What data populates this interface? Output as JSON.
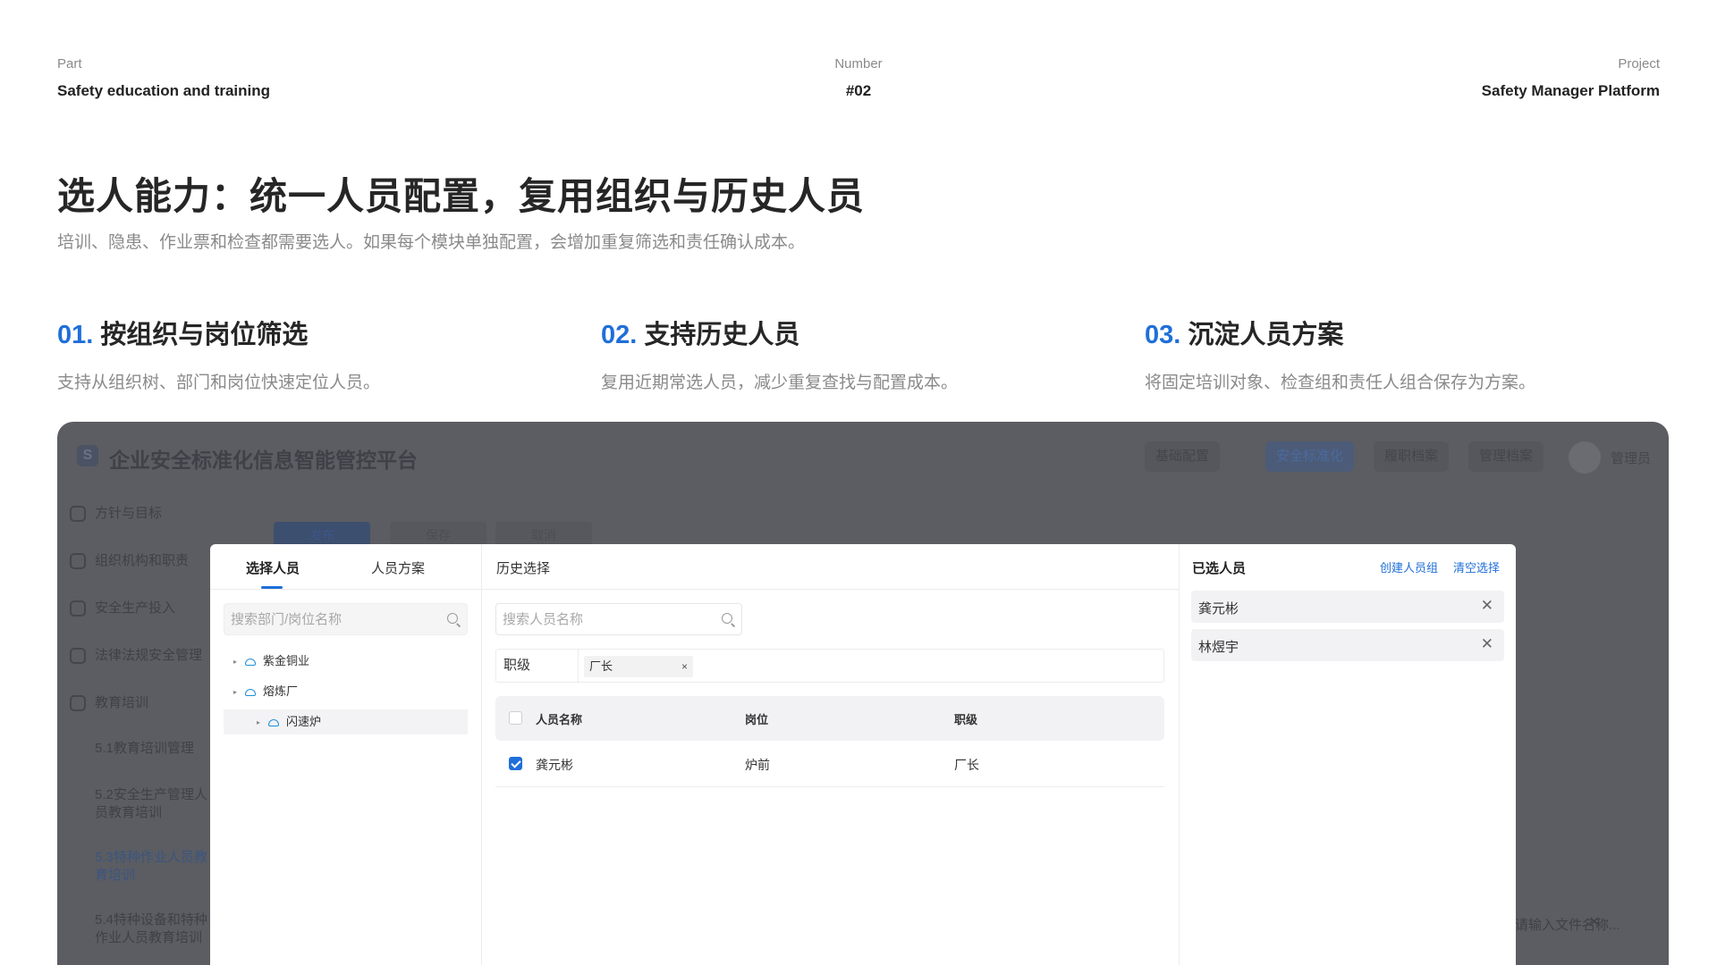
{
  "meta": {
    "part_label": "Part",
    "part_value": "Safety education and training",
    "number_label": "Number",
    "number_value": "#02",
    "project_label": "Project",
    "project_value": "Safety Manager Platform"
  },
  "title": "选人能力：统一人员配置，复用组织与历史人员",
  "subtitle": "培训、隐患、作业票和检查都需要选人。如果每个模块单独配置，会增加重复筛选和责任确认成本。",
  "features": [
    {
      "num": "01.",
      "title": "按组织与岗位筛选",
      "desc": "支持从组织树、部门和岗位快速定位人员。"
    },
    {
      "num": "02.",
      "title": "支持历史人员",
      "desc": "复用近期常选人员，减少重复查找与配置成本。"
    },
    {
      "num": "03.",
      "title": "沉淀人员方案",
      "desc": "将固定培训对象、检查组和责任人组合保存为方案。"
    }
  ],
  "background_app": {
    "logo_letter": "S",
    "app_name": "企业安全标准化信息智能管控平台",
    "top_tabs": [
      "基础配置",
      "安全标准化",
      "履职档案",
      "管理档案"
    ],
    "active_top_tab": "安全标准化",
    "admin": "管理员",
    "sidebar": [
      "方针与目标",
      "组织机构和职责",
      "安全生产投入",
      "法律法规安全管理",
      "教育培训"
    ],
    "sidebar_sub": [
      "5.1教育培训管理",
      "5.2安全生产管理人员教育培训",
      "5.3特种作业人员教育培训",
      "5.4特种设备和特种作业人员教育培训"
    ],
    "action_buttons": [
      "发布",
      "保存",
      "取消"
    ],
    "search_hint": "请输入文件名称...",
    "search_clear": "✕"
  },
  "modal": {
    "tabs": [
      "选择人员",
      "人员方案",
      "历史选择"
    ],
    "active_tab": "选择人员",
    "dept_search_placeholder": "搜索部门/岗位名称",
    "tree": [
      {
        "label": "紫金铜业",
        "level": 0
      },
      {
        "label": "熔炼厂",
        "level": 0
      },
      {
        "label": "闪速炉",
        "level": 1,
        "selected": true
      }
    ],
    "person_search_placeholder": "搜索人员名称",
    "filter_label": "职级",
    "filter_chip": "厂长",
    "chip_close": "×",
    "table": {
      "columns": [
        "人员名称",
        "岗位",
        "职级"
      ],
      "rows": [
        {
          "name": "龚元彬",
          "post": "炉前",
          "rank": "厂长",
          "checked": true
        }
      ]
    },
    "selected_title": "已选人员",
    "create_group": "创建人员组",
    "clear_selection": "清空选择",
    "selected": [
      "龚元彬",
      "林煜宇"
    ],
    "remove_icon": "✕"
  },
  "colors": {
    "accent": "#1f6fd8",
    "overlay": "#5b5d62"
  }
}
